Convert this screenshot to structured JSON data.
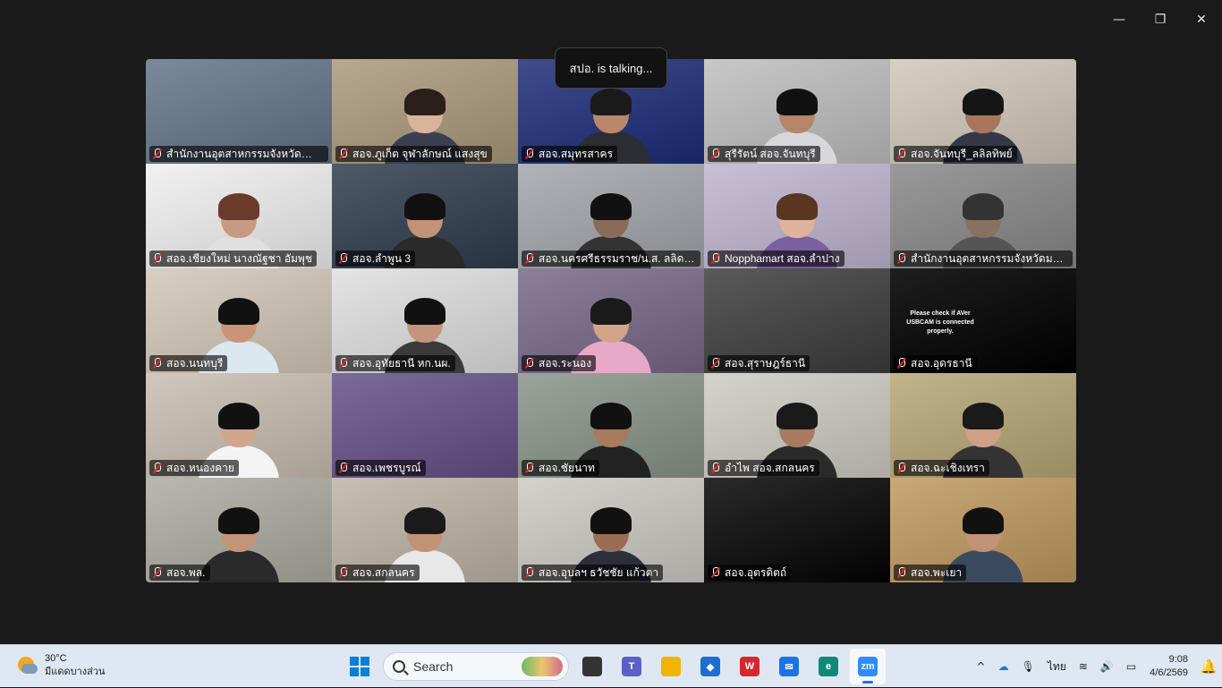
{
  "window": {
    "controls": {
      "minimize": "—",
      "restore": "❐",
      "close": "✕"
    }
  },
  "meeting": {
    "talking_indicator": "สปอ. is talking...",
    "participants": [
      {
        "name": "สำนักงานอุตสาหกรรมจังหวัดอำนา...",
        "bg": "#7a8a9a",
        "person": false
      },
      {
        "name": "สอจ.ภูเก็ต จุฬาลักษณ์ แสงสุข",
        "bg": "#b8a890",
        "person": true,
        "skin": "#d9b39a",
        "hair": "#2a1f1a",
        "shirt": "#3a3f50"
      },
      {
        "name": "สอจ.สมุทรสาคร",
        "bg": "#3f4c8e",
        "person": true,
        "skin": "#b9876a",
        "hair": "#1a1a1a",
        "shirt": "#2c2c34"
      },
      {
        "name": "สุรีรัตน์ สอจ.จันทบุรี",
        "bg": "#c8c8c8",
        "person": true,
        "skin": "#b58568",
        "hair": "#111",
        "shirt": "#d8d8dc"
      },
      {
        "name": "สอจ.จันทบุรี_ลลิลทิพย์",
        "bg": "#d8d0c4",
        "person": true,
        "skin": "#a8765a",
        "hair": "#151515",
        "shirt": "#353845"
      },
      {
        "name": "สอจ.เชียงใหม่ นางณัฐชา อัมพุช",
        "bg": "#f2f2f2",
        "person": true,
        "skin": "#c99a82",
        "hair": "#6a3a2a",
        "shirt": "#e0e0e0"
      },
      {
        "name": "สอจ.ลำพูน 3",
        "bg": "#4e5a68",
        "person": true,
        "skin": "#c49279",
        "hair": "#111",
        "shirt": "#2a2a2a"
      },
      {
        "name": "สอจ.นครศรีธรรมราช/น.ส. ลลิดา สั...",
        "bg": "#b0b4b8",
        "person": true,
        "skin": "#8a6a58",
        "hair": "#111",
        "shirt": "#333"
      },
      {
        "name": "Nopphamart สอจ.ลำปาง",
        "bg": "#c9c0d8",
        "person": true,
        "skin": "#e0b49c",
        "hair": "#5a3520",
        "shirt": "#7a5fa0"
      },
      {
        "name": "สำนักงานอุตสาหกรรมจังหวัดมหาส...",
        "bg": "#9a9a9a",
        "person": true,
        "skin": "#8a7060",
        "hair": "#333",
        "shirt": "#555"
      },
      {
        "name": "สอจ.นนทบุรี",
        "bg": "#d9cfc2",
        "person": true,
        "skin": "#c99478",
        "hair": "#111",
        "shirt": "#dce8f0"
      },
      {
        "name": "สอจ.อุทัยธานี หก.นผ.",
        "bg": "#e4e4e4",
        "person": true,
        "skin": "#c4957c",
        "hair": "#111",
        "shirt": "#3a3a3a"
      },
      {
        "name": "สอจ.ระนอง",
        "bg": "#8d7f9a",
        "person": true,
        "skin": "#d4a488",
        "hair": "#1a1a1a",
        "shirt": "#e8a8c8"
      },
      {
        "name": "สอจ.สุราษฎร์ธานี",
        "bg": "#5a5a5a",
        "person": false
      },
      {
        "name": "สอจ.อุดรธานี",
        "bg": "#1e1e1e",
        "person": false,
        "message": "Please check if AVer USBCAM is connected properly."
      },
      {
        "name": "สอจ.หนองคาย",
        "bg": "#d0c8bc",
        "person": true,
        "skin": "#d2a68c",
        "hair": "#111",
        "shirt": "#f4f4f4"
      },
      {
        "name": "สอจ.เพชรบูรณ์",
        "bg": "#7c6a9a",
        "person": false
      },
      {
        "name": "สอจ.ชัยนาท",
        "bg": "#9aa49a",
        "person": true,
        "skin": "#a87a5e",
        "hair": "#111",
        "shirt": "#222"
      },
      {
        "name": "อำไพ สอจ.สกลนคร",
        "bg": "#d6d2cc",
        "person": true,
        "skin": "#a87a5e",
        "hair": "#1a1a1a",
        "shirt": "#2a2a2a"
      },
      {
        "name": "สอจ.ฉะเชิงเทรา",
        "bg": "#c2b48a",
        "person": true,
        "skin": "#d0a086",
        "hair": "#1a1a1a",
        "shirt": "#333"
      },
      {
        "name": "สอจ.พล.",
        "bg": "#b8b8b0",
        "person": true,
        "skin": "#c49478",
        "hair": "#111",
        "shirt": "#2a2a2a"
      },
      {
        "name": "สอจ.สกลนคร",
        "bg": "#c8bfb4",
        "person": true,
        "skin": "#c29277",
        "hair": "#1a1a1a",
        "shirt": "#e8e8e8"
      },
      {
        "name": "สอจ.อุบลฯ ธวัชชัย แก้วตา",
        "bg": "#d4d2cc",
        "person": true,
        "skin": "#9a6e55",
        "hair": "#111",
        "shirt": "#2a2f3a"
      },
      {
        "name": "สอจ.อุตรดิตถ์",
        "bg": "#2a2a2a",
        "person": false
      },
      {
        "name": "สอจ.พะเยา",
        "bg": "#c9a878",
        "person": true,
        "skin": "#c29277",
        "hair": "#111",
        "shirt": "#3a4a5e"
      }
    ]
  },
  "taskbar": {
    "weather": {
      "temp": "30°C",
      "desc": "มีแดดบางส่วน"
    },
    "search_placeholder": "Search",
    "apps": [
      {
        "name": "windows-start",
        "color": "#0a7fd9"
      },
      {
        "name": "task-view",
        "color": "#333",
        "label": ""
      },
      {
        "name": "teams",
        "color": "#5b5fc7",
        "label": "T"
      },
      {
        "name": "file-explorer",
        "color": "#f2b400",
        "label": ""
      },
      {
        "name": "store",
        "color": "#1a6fd1",
        "label": "◆"
      },
      {
        "name": "wps-office",
        "color": "#d9262d",
        "label": "W"
      },
      {
        "name": "mail",
        "color": "#1a73e8",
        "label": "✉"
      },
      {
        "name": "edge",
        "color": "#0c8a7a",
        "label": "e"
      },
      {
        "name": "zoom",
        "color": "#2d8cff",
        "label": "zm"
      }
    ],
    "tray": {
      "chevron": "^",
      "cloud": "☁",
      "mic": "🎙",
      "language": "ไทย",
      "wifi": "≋",
      "volume": "🔊",
      "battery": "▭"
    },
    "clock": {
      "time": "9:08",
      "date": "4/6/2569"
    },
    "notification": "🔔"
  }
}
